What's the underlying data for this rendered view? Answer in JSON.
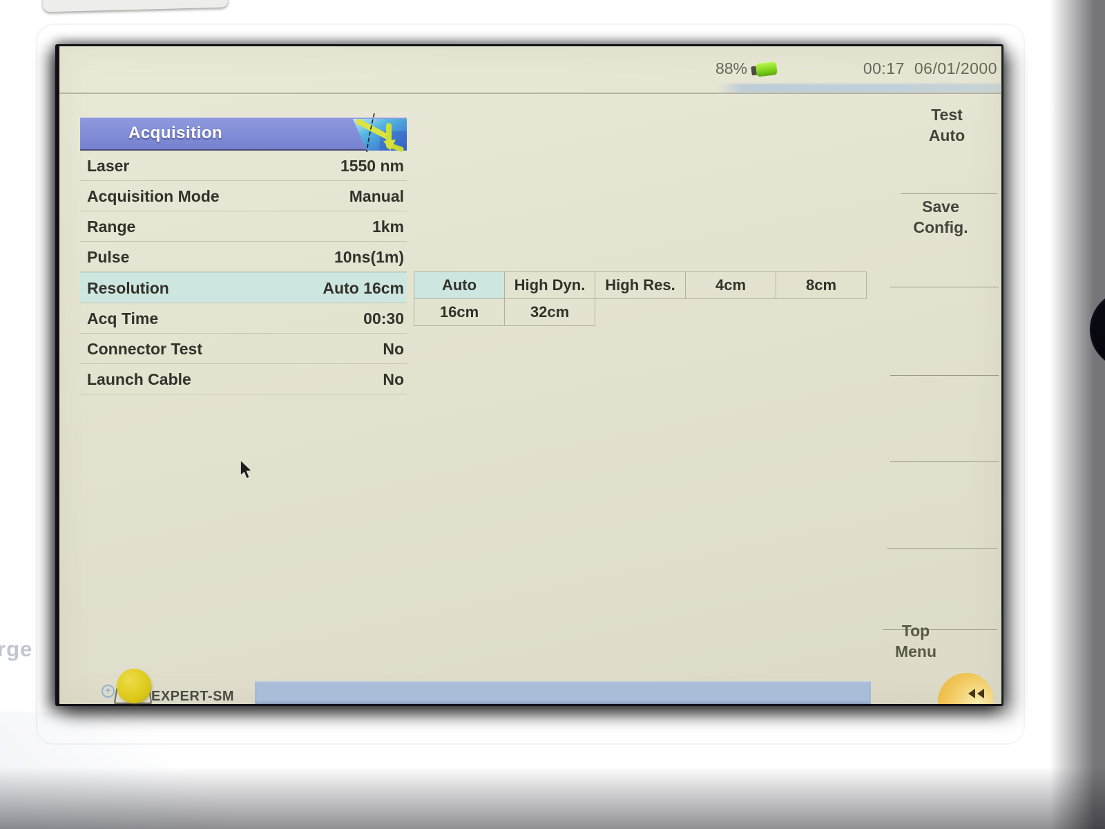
{
  "bezel": {
    "partial_label": "rge"
  },
  "status_bar": {
    "battery_percent": "88%",
    "time": "00:17",
    "date": "06/01/2000"
  },
  "panel": {
    "title": "Acquisition",
    "rows": [
      {
        "label": "Laser",
        "value": "1550 nm"
      },
      {
        "label": "Acquisition Mode",
        "value": "Manual"
      },
      {
        "label": "Range",
        "value": "1km"
      },
      {
        "label": "Pulse",
        "value": "10ns(1m)"
      },
      {
        "label": "Resolution",
        "value": "Auto 16cm",
        "selected": true
      },
      {
        "label": "Acq Time",
        "value": "00:30"
      },
      {
        "label": "Connector Test",
        "value": "No"
      },
      {
        "label": "Launch Cable",
        "value": "No"
      }
    ]
  },
  "resolution_options": {
    "row1": [
      "Auto",
      "High Dyn.",
      "High Res.",
      "4cm",
      "8cm"
    ],
    "row2": [
      "16cm",
      "32cm"
    ],
    "selected": "Auto"
  },
  "softkeys": {
    "test_auto": [
      "Test",
      "Auto"
    ],
    "save_config": [
      "Save",
      "Config."
    ],
    "top_menu": [
      "Top",
      "Menu"
    ]
  },
  "taskbar": {
    "label": "EXPERT-SM"
  },
  "colors": {
    "header_blue": "#7e8ad3",
    "screen_bg": "#e3e2cf",
    "highlight": "#cde7e0",
    "taskbar_blue": "#a9bdd9",
    "battery_green": "#84d81e",
    "accent_yellow": "#dcc817"
  }
}
